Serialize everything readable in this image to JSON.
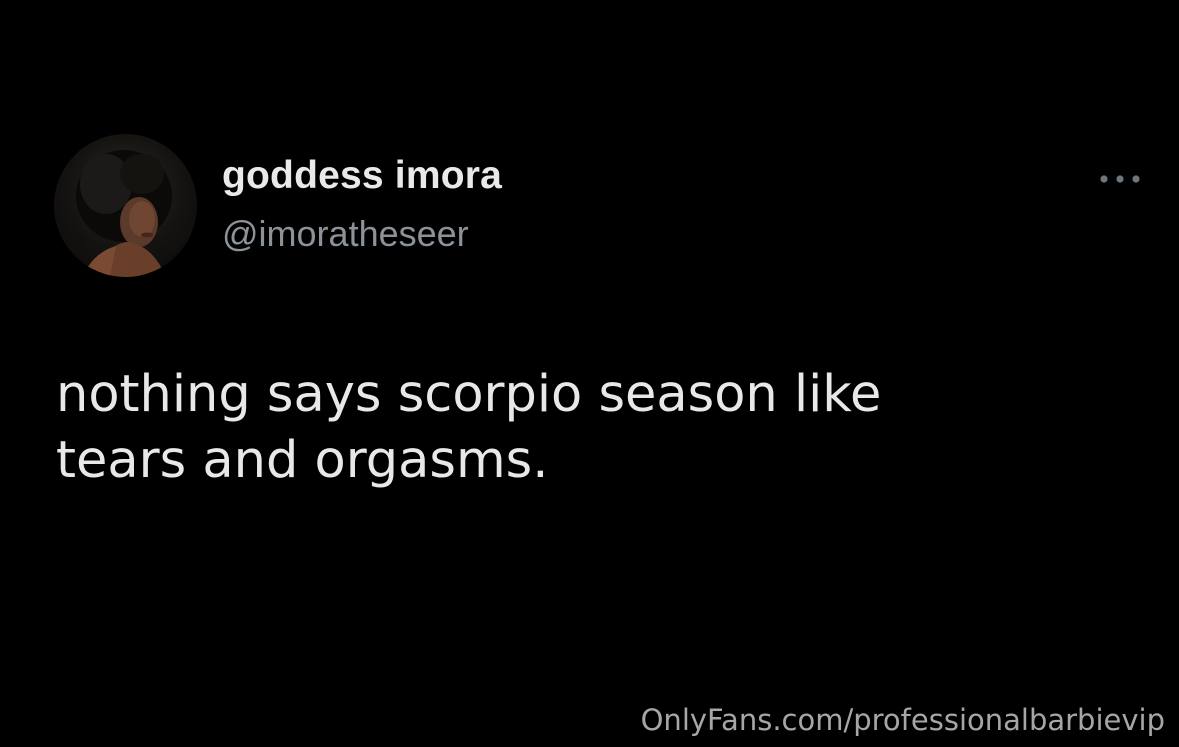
{
  "tweet": {
    "author": {
      "display_name": "goddess imora",
      "handle": "@imoratheseer",
      "avatar": "profile-photo"
    },
    "more_icon": "more-horizontal-icon",
    "text_lines": [
      "nothing says scorpio season like",
      "tears and orgasms."
    ]
  },
  "watermark": {
    "text": "OnlyFans.com/professionalbarbievip"
  },
  "colors": {
    "background": "#000000",
    "name": "#e9e9e9",
    "handle": "#8b9299",
    "body_text": "#e8e8e8",
    "watermark": "#b8b8b8"
  }
}
